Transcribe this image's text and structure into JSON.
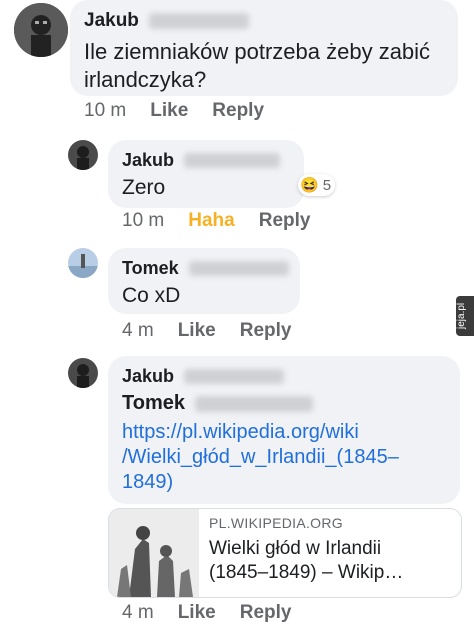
{
  "comments": [
    {
      "author": "Jakub",
      "text_lines": [
        "Ile ziemniaków potrzeba żeby zabić",
        "irlandczyka?"
      ],
      "time": "10 m",
      "like": "Like",
      "reply": "Reply"
    },
    {
      "author": "Jakub",
      "text": "Zero",
      "time": "10 m",
      "reaction_label": "Haha",
      "reply": "Reply",
      "reaction_count": "5",
      "reaction_emoji": "😆"
    },
    {
      "author": "Tomek",
      "text": "Co xD",
      "time": "4 m",
      "like": "Like",
      "reply": "Reply"
    },
    {
      "author": "Jakub",
      "mention": "Tomek",
      "link_lines": [
        "https://pl.wikipedia.org/wiki",
        "/Wielki_głód_w_Irlandii_(1845–",
        "1849)"
      ],
      "preview": {
        "domain": "PL.WIKIPEDIA.ORG",
        "title_lines": [
          "Wielki głód w Irlandii",
          "(1845–1849) – Wikip…"
        ]
      },
      "time": "4 m",
      "like": "Like",
      "reply": "Reply"
    }
  ],
  "side_tag": "jeja.pl",
  "colors": {
    "bubble": "#f0f2f5",
    "link": "#216fdb",
    "haha": "#f7b125",
    "meta": "#65676b"
  }
}
